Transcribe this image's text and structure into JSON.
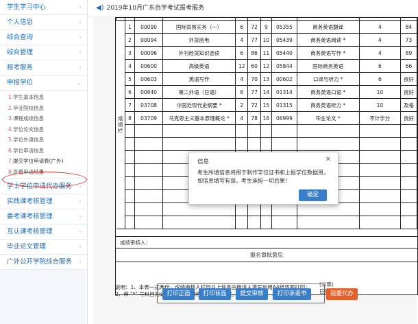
{
  "sidebar": {
    "items_top": [
      {
        "label": "学生学习中心"
      },
      {
        "label": "个人信息"
      },
      {
        "label": "综合查询"
      },
      {
        "label": "综合管理"
      },
      {
        "label": "报考服务"
      }
    ],
    "degree_menu": {
      "label": "申报学位",
      "chevron": "chevron-down-icon"
    },
    "sub_items": [
      {
        "num": "1.",
        "label": "学生基本信息"
      },
      {
        "num": "2.",
        "label": "毕业院校信息"
      },
      {
        "num": "3.",
        "label": "课程成绩信息"
      },
      {
        "num": "4.",
        "label": "学位论文信息"
      },
      {
        "num": "5.",
        "label": "学位外语信息"
      },
      {
        "num": "6.",
        "label": "学位申请信息"
      },
      {
        "num": "7.",
        "label": "提交学位申请表(广外)"
      },
      {
        "num": "8.",
        "label": "查看申请结果"
      }
    ],
    "items_bottom": [
      {
        "label": "学士学位申请代办服务"
      },
      {
        "label": "实践课考核管理"
      },
      {
        "label": "委考课考核管理"
      },
      {
        "label": "互认课考核管理"
      },
      {
        "label": "毕业论文管理"
      },
      {
        "label": "广外公开学院综合服务"
      }
    ]
  },
  "tab": {
    "icon": "speaker-icon",
    "title": "2019年10月广东自学考试报考服务"
  },
  "table": {
    "side_label": "成绩栏",
    "rows": [
      {
        "no": "1",
        "code": "00090",
        "name": "国际贸易实务（一）",
        "c1": "6",
        "c2": "72",
        "c3": "9",
        "code2": "05355",
        "name2": "商务英语翻译",
        "credit": "4",
        "score": "84"
      },
      {
        "no": "2",
        "code": "00094",
        "name": "外贸函电",
        "c1": "4",
        "c2": "77",
        "c3": "10",
        "code2": "05439",
        "name2": "商务英语阅读 *",
        "credit": "4",
        "score": "73"
      },
      {
        "no": "3",
        "code": "00096",
        "name": "外刊经贸知识选读",
        "c1": "6",
        "c2": "86",
        "c3": "11",
        "code2": "05440",
        "name2": "商务英语写作 *",
        "credit": "4",
        "score": "89"
      },
      {
        "no": "4",
        "code": "00600",
        "name": "高级英语",
        "c1": "12",
        "c2": "60",
        "c3": "12",
        "code2": "05844",
        "name2": "国际商务英语",
        "credit": "6",
        "score": "66"
      },
      {
        "no": "5",
        "code": "00603",
        "name": "英语写作",
        "c1": "4",
        "c2": "70",
        "c3": "13",
        "code2": "00602",
        "name2": "口译与听力 *",
        "credit": "6",
        "score": "良好"
      },
      {
        "no": "6",
        "code": "00840",
        "name": "第二外语（日语）",
        "c1": "6",
        "c2": "77",
        "c3": "14",
        "code2": "01314",
        "name2": "商务英语口语 *",
        "credit": "10",
        "score": "良好"
      },
      {
        "no": "7",
        "code": "03708",
        "name": "中国近现代史纲要 *",
        "c1": "2",
        "c2": "72",
        "c3": "15",
        "code2": "01315",
        "name2": "商务英语听力 *",
        "credit": "10",
        "score": "及格"
      },
      {
        "no": "8",
        "code": "03709",
        "name": "马克思主义基本原理概论 *",
        "c1": "4",
        "c2": "78",
        "c3": "16",
        "code2": "06999",
        "name2": "毕业论文 *",
        "credit": "不计学分",
        "score": "良好"
      }
    ],
    "empty_rows": 8
  },
  "reviewer_label": "成绩审核人：",
  "opinion_label": "报名审批意见",
  "seal_label": "(公章)",
  "date_label": "日期：",
  "notes": {
    "line1": "说明：1、本表一式两份，成绩审核人栏目以上信息由申请人填写后用A4纸双面打印；",
    "line2": "2、带 \"*\" 号科目为公共课、实践课程以及加考课程。"
  },
  "buttons": {
    "print_front": "打印正面",
    "print_back": "打印背面",
    "submit_review": "提交审核",
    "print_pledge": "打印承诺书",
    "agent": "我要代办"
  },
  "modal": {
    "title": "信息",
    "message": "考生所填信息将用于制作学位证书和上报学位数据用，如信息填写有误，考生承担一切后果！",
    "ok": "确定"
  },
  "colors": {
    "link": "#1e6bb8",
    "accent_red": "#e0322b",
    "button_blue": "#3a7dc9",
    "button_orange": "#e4602b"
  }
}
